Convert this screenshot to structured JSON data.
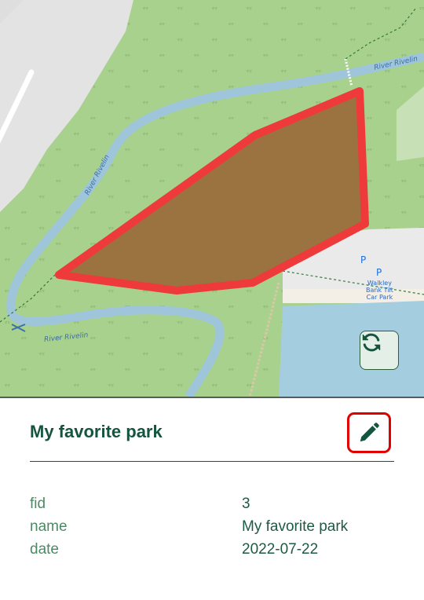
{
  "map": {
    "labels": {
      "river_top": "River Rivelin",
      "river_mid": "River Rivelin",
      "river_bottom": "River Rivelin",
      "parking_symbol_1": "P",
      "parking_symbol_2": "P",
      "parking_name": [
        "Walkley",
        "Bank Tilt",
        "Car Park"
      ]
    },
    "colors": {
      "woodland": "#a9d18e",
      "river": "#9ec5d9",
      "lake": "#a4cde0",
      "road_area": "#e0e0e0",
      "polygon_fill": "#9b7341",
      "polygon_stroke": "#ee3a3a",
      "accent": "#15543f"
    },
    "sync_icon": "sync-icon"
  },
  "feature": {
    "title": "My favorite park",
    "edit_icon": "pencil-icon",
    "attributes": [
      {
        "key": "fid",
        "value": "3"
      },
      {
        "key": "name",
        "value": "My favorite park"
      },
      {
        "key": "date",
        "value": "2022-07-22"
      }
    ]
  }
}
